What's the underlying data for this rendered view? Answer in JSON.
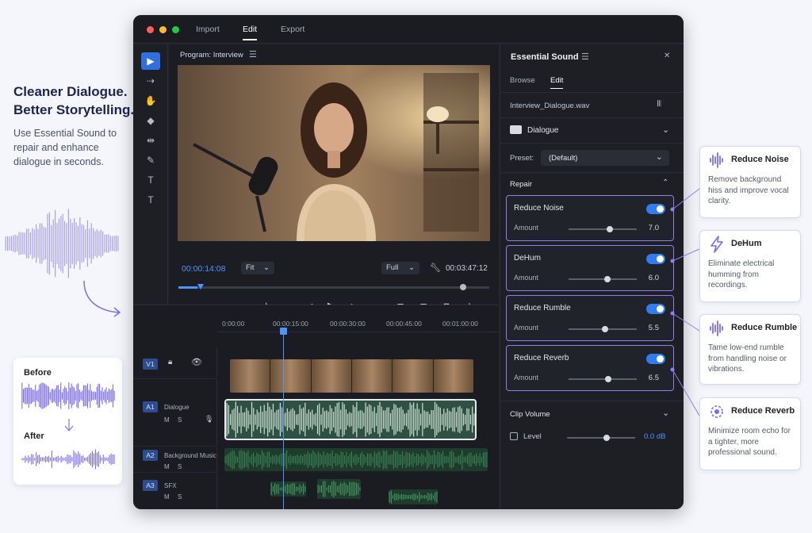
{
  "hero": {
    "title_line1": "Cleaner Dialogue.",
    "title_line2": "Better Storytelling.",
    "subtitle": "Use Essential Sound to repair and enhance dialogue in seconds."
  },
  "before_after": {
    "before": "Before",
    "after": "After"
  },
  "window": {
    "menus": [
      "Import",
      "Edit",
      "Export"
    ],
    "active_menu": "Edit"
  },
  "program": {
    "title": "Program: Interview",
    "timecode": "00:00:14:08",
    "fit": "Fit",
    "quality": "Full",
    "duration": "00:03:47:12",
    "progress": 0.06
  },
  "timeline": {
    "ruler": [
      "0:00:00",
      "00:00:15:00",
      "00:00:30:00",
      "00:00:45:00",
      "00:01:00:00"
    ],
    "tracks": [
      {
        "tag": "V1",
        "name": ""
      },
      {
        "tag": "A1",
        "name": "Dialogue",
        "m": "M",
        "s": "S"
      },
      {
        "tag": "A2",
        "name": "Background Music",
        "m": "M",
        "s": "S"
      },
      {
        "tag": "A3",
        "name": "SFX",
        "m": "M",
        "s": "S"
      }
    ]
  },
  "panel": {
    "title": "Essential Sound",
    "tabs": [
      "Browse",
      "Edit"
    ],
    "active_tab": "Edit",
    "file": "Interview_Dialogue.wav",
    "type": "Dialogue",
    "preset_label": "Preset:",
    "preset_value": "(Default)",
    "repair_label": "Repair",
    "repairs": [
      {
        "name": "Reduce Noise",
        "amount_label": "Amount",
        "value": "7.0",
        "level": 0.6
      },
      {
        "name": "DeHum",
        "amount_label": "Amount",
        "value": "6.0",
        "level": 0.57
      },
      {
        "name": "Reduce Rumble",
        "amount_label": "Amount",
        "value": "5.5",
        "level": 0.53
      },
      {
        "name": "Reduce Reverb",
        "amount_label": "Amount",
        "value": "6.5",
        "level": 0.58
      }
    ],
    "clip_volume": "Clip Volume",
    "level_label": "Level",
    "level_value": "0.0 dB"
  },
  "callouts": [
    {
      "title": "Reduce Noise",
      "desc": "Remove background hiss and improve vocal clarity.",
      "icon": "waveform-icon"
    },
    {
      "title": "DeHum",
      "desc": "Eliminate electrical humming from recordings.",
      "icon": "lightning-icon"
    },
    {
      "title": "Reduce Rumble",
      "desc": "Tame low-end rumble from handling noise or vibrations.",
      "icon": "waveform-icon"
    },
    {
      "title": "Reduce Reverb",
      "desc": "Minimize room echo for a tighter, more professional sound.",
      "icon": "reverb-icon"
    }
  ],
  "colors": {
    "accent": "#2f7df0",
    "callout_border": "#8d7ff0",
    "waveform": "#7b6cf0",
    "audio_green": "#3d8a5a"
  }
}
